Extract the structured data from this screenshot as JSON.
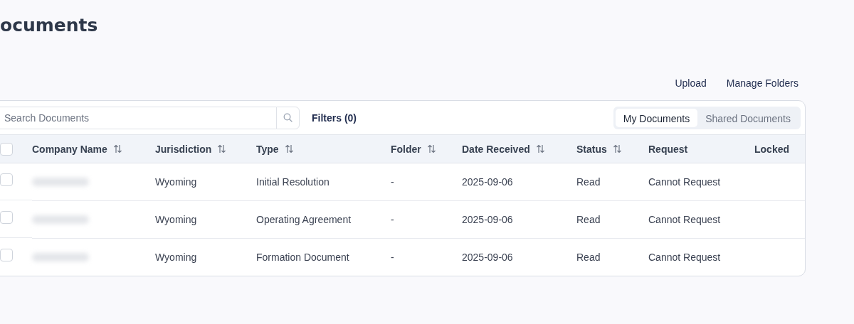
{
  "page_title": "ocuments",
  "actions": [
    "Upload",
    "Manage Folders"
  ],
  "search": {
    "placeholder": "Search Documents"
  },
  "filters": "Filters (0)",
  "tabs": [
    {
      "label": "My Documents",
      "selected": true
    },
    {
      "label": "Shared Documents",
      "selected": false
    }
  ],
  "table": {
    "select_all_checked": false,
    "columns": [
      {
        "label": "Company Name",
        "sortable": true
      },
      {
        "label": "Jurisdiction",
        "sortable": true
      },
      {
        "label": "Type",
        "sortable": true
      },
      {
        "label": "Folder",
        "sortable": true
      },
      {
        "label": "Date Received",
        "sortable": true
      },
      {
        "label": "Status",
        "sortable": true
      },
      {
        "label": "Request",
        "sortable": false
      },
      {
        "label": "Locked",
        "sortable": false
      }
    ],
    "rows": [
      {
        "checked": false,
        "company_redacted": true,
        "jurisdiction": "Wyoming",
        "type": "Initial Resolution",
        "folder": "-",
        "date_received": "2025-09-06",
        "status": "Read",
        "request": "Cannot Request"
      },
      {
        "checked": false,
        "company_redacted": true,
        "jurisdiction": "Wyoming",
        "type": "Operating Agreement",
        "folder": "-",
        "date_received": "2025-09-06",
        "status": "Read",
        "request": "Cannot Request"
      },
      {
        "checked": false,
        "company_redacted": true,
        "jurisdiction": "Wyoming",
        "type": "Formation Document",
        "folder": "-",
        "date_received": "2025-09-06",
        "status": "Read",
        "request": "Cannot Request"
      }
    ]
  }
}
